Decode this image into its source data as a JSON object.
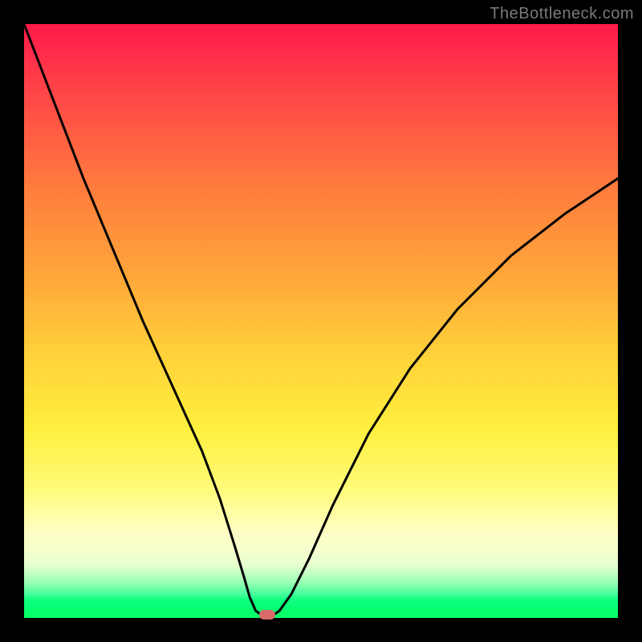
{
  "watermark": "TheBottleneck.com",
  "chart_data": {
    "type": "line",
    "title": "",
    "xlabel": "",
    "ylabel": "",
    "xlim": [
      0,
      100
    ],
    "ylim": [
      0,
      100
    ],
    "grid": false,
    "legend": false,
    "series": [
      {
        "name": "curve",
        "x": [
          0,
          5,
          10,
          15,
          20,
          25,
          30,
          33,
          35.5,
          37,
          38,
          39,
          40,
          41,
          42,
          43,
          45,
          48,
          52,
          58,
          65,
          73,
          82,
          91,
          100
        ],
        "y": [
          100,
          87,
          74,
          62,
          50,
          39,
          28,
          20,
          12,
          7,
          3.5,
          1.2,
          0.5,
          0.5,
          0.5,
          1.2,
          4,
          10,
          19,
          31,
          42,
          52,
          61,
          68,
          74
        ]
      }
    ],
    "marker": {
      "x": 41,
      "y": 0.5,
      "shape": "pill",
      "color": "#d86a6a"
    },
    "background_gradient": {
      "type": "vertical",
      "stops": [
        {
          "pos": 0,
          "color": "#ff1a4b"
        },
        {
          "pos": 50,
          "color": "#ffd23a"
        },
        {
          "pos": 85,
          "color": "#ffffc7"
        },
        {
          "pos": 100,
          "color": "#05ff68"
        }
      ]
    }
  },
  "colors": {
    "frame": "#000000",
    "curve": "#000000",
    "marker": "#d86a6a",
    "watermark": "#7a7a7a"
  }
}
